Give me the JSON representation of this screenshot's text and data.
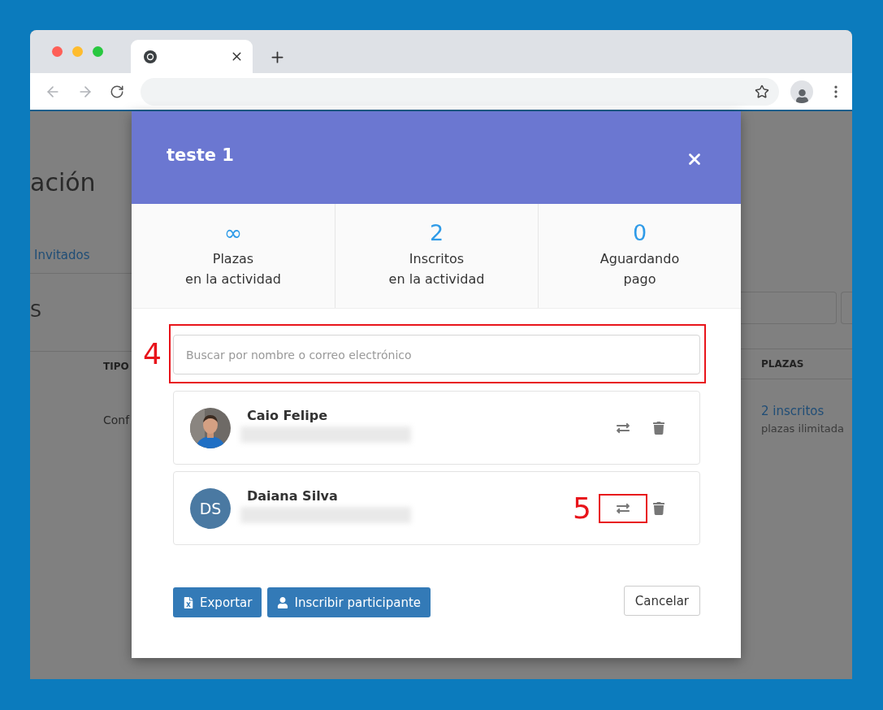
{
  "background_page": {
    "heading": "ación",
    "tabs": [
      "Invitados"
    ],
    "section_title": "S",
    "table": {
      "columns": [
        "TIPO",
        "PLAZAS"
      ],
      "rows": [
        {
          "tipo": "Conf",
          "plazas": "2 inscritos",
          "plazas_note": "plazas ilimitada"
        }
      ]
    }
  },
  "modal": {
    "title": "teste 1",
    "stats": [
      {
        "value": "∞",
        "label": "Plazas\nen la actividad"
      },
      {
        "value": "2",
        "label": "Inscritos\nen la actividad"
      },
      {
        "value": "0",
        "label": "Aguardando\npago"
      }
    ],
    "search": {
      "placeholder": "Buscar por nombre o correo electrónico",
      "annotation": "4"
    },
    "participants": [
      {
        "name": "Caio Felipe"
      },
      {
        "name": "Daiana Silva",
        "avatar": {
          "kind": "initials",
          "initials": "DS"
        },
        "annotation": "5"
      }
    ],
    "buttons": [
      {
        "kind": "export",
        "label": "Exportar"
      },
      {
        "kind": "enroll",
        "label": "Inscribir participante"
      }
    ],
    "cancel": "Cancelar"
  }
}
